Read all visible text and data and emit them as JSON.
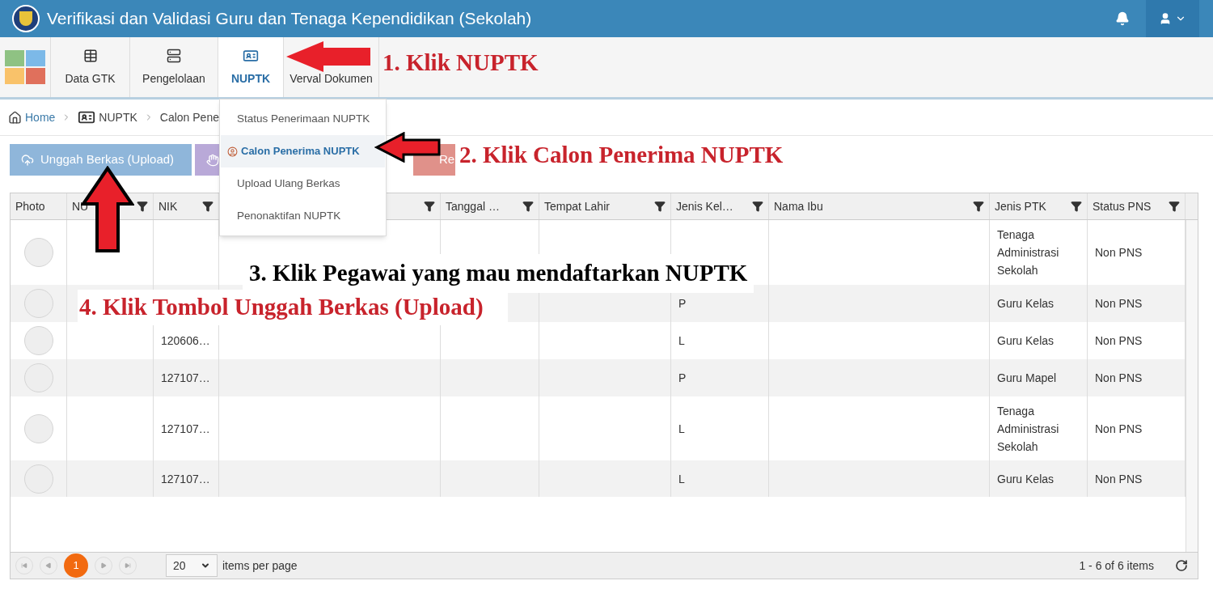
{
  "header": {
    "title": "Verifikasi dan Validasi Guru dan Tenaga Kependidikan (Sekolah)"
  },
  "nav": [
    {
      "label": "Data GTK",
      "selected": false
    },
    {
      "label": "Pengelolaan",
      "selected": false
    },
    {
      "label": "NUPTK",
      "selected": true
    },
    {
      "label": "Verval Dokumen",
      "selected": false
    }
  ],
  "dropdown": [
    {
      "label": "Status Penerimaan NUPTK",
      "selected": false
    },
    {
      "label": "Calon Penerima NUPTK",
      "selected": true
    },
    {
      "label": "Upload Ulang Berkas",
      "selected": false
    },
    {
      "label": "Penonaktifan NUPTK",
      "selected": false
    }
  ],
  "breadcrumb": [
    {
      "label": "Home",
      "kind": "home"
    },
    {
      "label": "NUPTK",
      "kind": "card"
    },
    {
      "label": "Calon Pene",
      "kind": "text"
    }
  ],
  "toolbar": [
    {
      "label": "Unggah Berkas (Upload)",
      "kind": "upload"
    },
    {
      "kind": "hand"
    },
    {
      "label": "Re",
      "kind": "file"
    }
  ],
  "columns": [
    {
      "label": "Photo"
    },
    {
      "label": "NU"
    },
    {
      "label": "NIK"
    },
    {},
    {
      "label": "Tanggal …"
    },
    {
      "label": "Tempat Lahir"
    },
    {
      "label": "Jenis Kel…"
    },
    {
      "label": "Nama Ibu"
    },
    {
      "label": "Jenis PTK"
    },
    {
      "label": "Status PNS"
    }
  ],
  "rows": [
    {
      "ptk": "Tenaga Administrasi Sekolah",
      "status": "Non PNS"
    },
    {
      "jk": "P",
      "ptk": "Guru Kelas",
      "status": "Non PNS"
    },
    {
      "nik": "120606…",
      "jk": "L",
      "ptk": "Guru Kelas",
      "status": "Non PNS"
    },
    {
      "nik": "127107…",
      "jk": "P",
      "ptk": "Guru Mapel",
      "status": "Non PNS"
    },
    {
      "nik": "127107…",
      "jk": "L",
      "ptk": "Tenaga Administrasi Sekolah",
      "status": "Non PNS"
    },
    {
      "nik": "127107…",
      "jk": "L",
      "ptk": "Guru Kelas",
      "status": "Non PNS"
    }
  ],
  "pager": {
    "pages": [
      {
        "label": "1",
        "selected": true
      }
    ],
    "page_size": "20",
    "page_size_label": "items per page",
    "summary": "1 - 6 of 6 items"
  },
  "annotations": [
    {
      "text": "1. Klik NUPTK",
      "color": "#c8232c"
    },
    {
      "text": "2. Klik Calon Penerima NUPTK",
      "color": "#c8232c"
    },
    {
      "text": "3. Klik Pegawai yang mau mendaftarkan NUPTK",
      "color": "#000000"
    },
    {
      "text": "4. Klik Tombol Unggah Berkas (Upload)",
      "color": "#c8232c"
    }
  ]
}
